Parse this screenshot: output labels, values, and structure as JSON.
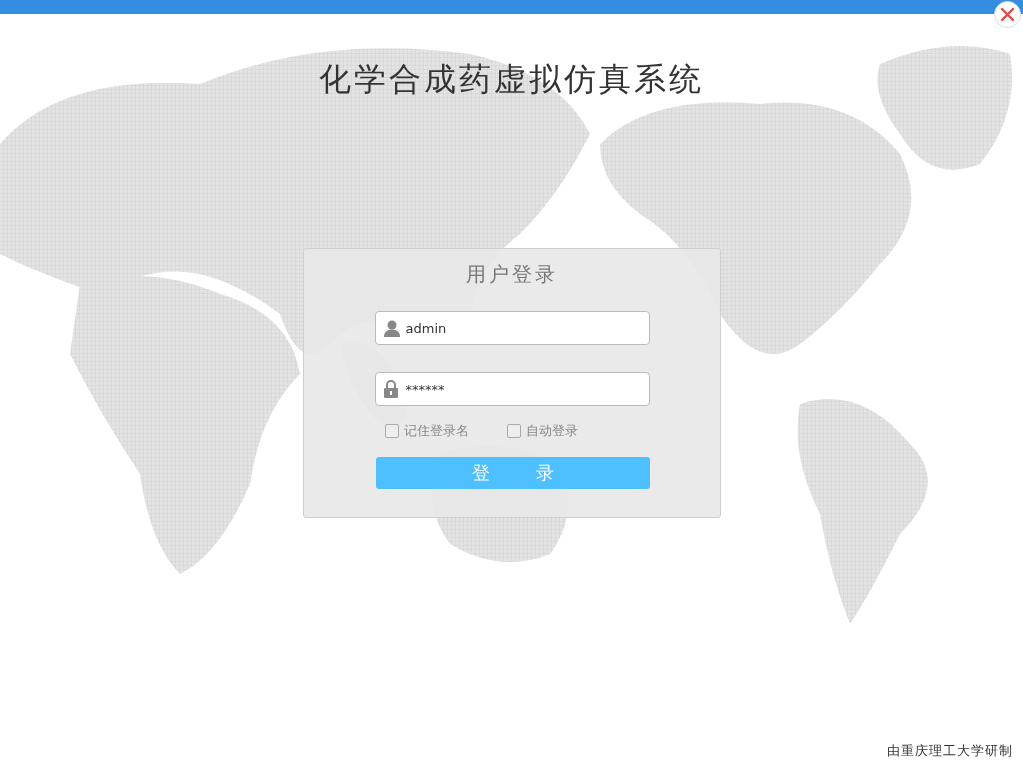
{
  "window": {
    "title": "化学合成药虚拟仿真系统"
  },
  "login": {
    "heading": "用户登录",
    "username": {
      "value": "admin"
    },
    "password": {
      "value": "******"
    },
    "options": [
      {
        "label": "记住登录名",
        "checked": false
      },
      {
        "label": "自动登录",
        "checked": false
      }
    ],
    "submit": "登　录"
  },
  "footer": "由重庆理工大学研制"
}
